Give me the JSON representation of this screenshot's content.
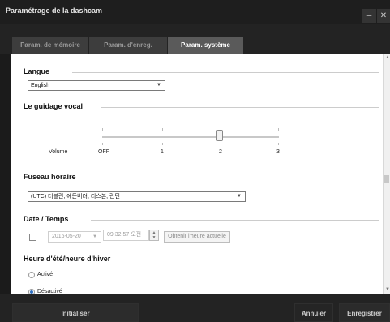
{
  "window": {
    "title": "Paramétrage de la dashcam",
    "minimize_symbol": "–",
    "close_symbol": "✕"
  },
  "tabs": [
    {
      "label": "Param. de mémoire",
      "active": false
    },
    {
      "label": "Param. d'enreg.",
      "active": false
    },
    {
      "label": "Param. système",
      "active": true
    }
  ],
  "langue": {
    "title": "Langue",
    "selected": "English"
  },
  "guidage_vocal": {
    "title": "Le guidage vocal",
    "volume_label": "Volume",
    "slider_labels": [
      "OFF",
      "1",
      "2",
      "3"
    ],
    "value": "2"
  },
  "fuseau": {
    "title": "Fuseau horaire",
    "selected": "(UTC) 더블린, 에든버러, 리스본, 런던"
  },
  "date_temps": {
    "title": "Date / Temps",
    "date": "2016-05-20",
    "time": "09:32:57 오전",
    "get_time_button": "Obtenir l'heure actuelle"
  },
  "dst": {
    "title": "Heure d'été/heure d'hiver",
    "options": [
      "Activé",
      "Désactivé"
    ],
    "selected": "Désactivé"
  },
  "footer": {
    "init": "Initialiser",
    "cancel": "Annuler",
    "save": "Enregistrer"
  }
}
